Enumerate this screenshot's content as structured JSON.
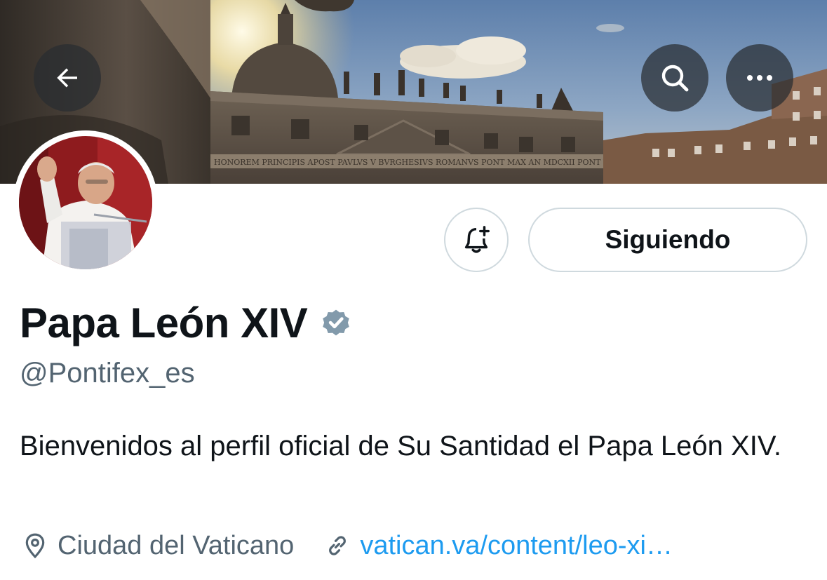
{
  "header": {
    "back_icon": "arrow-left-icon",
    "search_icon": "search-icon",
    "more_icon": "more-horizontal-icon"
  },
  "profile": {
    "display_name": "Papa León XIV",
    "verified_badge_color": "#829aab",
    "handle": "@Pontifex_es",
    "bio": "Bienvenidos al perfil oficial de Su Santidad el Papa León XIV.",
    "location": "Ciudad del Vaticano",
    "website": "vatican.va/content/leo-xi…"
  },
  "actions": {
    "notify_icon": "bell-plus-icon",
    "follow_label": "Siguiendo"
  },
  "banner": {
    "inscription": "HONOREM PRINCIPIS APOST PAVLVS V BVRGHESIVS ROMANVS PONT MAX AN MDCXII PONT VII"
  },
  "colors": {
    "text_primary": "#0f1419",
    "text_secondary": "#536471",
    "link": "#1d9bf0",
    "button_border": "#cfd9de"
  }
}
